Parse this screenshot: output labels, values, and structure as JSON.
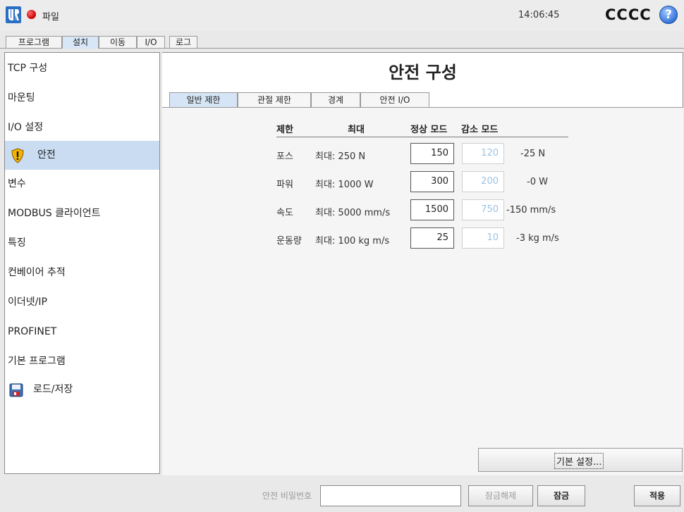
{
  "header": {
    "file_label": "파일",
    "clock": "14:06:45",
    "robot_name": "CCCC",
    "help_glyph": "?",
    "status_color": "#d40000"
  },
  "top_tabs": [
    "프로그램",
    "설치",
    "이동",
    "I/O",
    "로그"
  ],
  "active_top_tab": "설치",
  "sidebar": {
    "items": [
      {
        "label": "TCP 구성"
      },
      {
        "label": "마운팅"
      },
      {
        "label": "I/O 설정"
      },
      {
        "label": "안전",
        "icon": "warning-shield-icon",
        "active": true
      },
      {
        "label": "변수"
      },
      {
        "label": "MODBUS 클라이언트"
      },
      {
        "label": "특징"
      },
      {
        "label": "컨베이어 추적"
      },
      {
        "label": "이더넷/IP"
      },
      {
        "label": "PROFINET"
      },
      {
        "label": "기본 프로그램"
      },
      {
        "label": "로드/저장",
        "icon": "floppy-disk-icon"
      }
    ]
  },
  "main": {
    "title": "안전 구성",
    "subtabs": [
      "일반 제한",
      "관절 제한",
      "경계",
      "안전 I/O"
    ],
    "active_subtab": "일반 제한",
    "table": {
      "headers": {
        "limit": "제한",
        "max": "최대",
        "normal": "정상 모드",
        "reduced": "감소 모드"
      },
      "rows": [
        {
          "name": "포스",
          "max": "최대: 250 N",
          "normal": "150",
          "reduced": "120",
          "diff": "-25 N"
        },
        {
          "name": "파워",
          "max": "최대: 1000 W",
          "normal": "300",
          "reduced": "200",
          "diff": "-0 W"
        },
        {
          "name": "속도",
          "max": "최대: 5000 mm/s",
          "normal": "1500",
          "reduced": "750",
          "diff": "-150 mm/s"
        },
        {
          "name": "운동량",
          "max": "최대: 100 kg m/s",
          "normal": "25",
          "reduced": "10",
          "diff": "-3 kg m/s"
        }
      ]
    },
    "default_button": "기본 설정..."
  },
  "footer": {
    "password_label": "안전 비밀번호",
    "password_value": "",
    "unlock_button": "잠금해제",
    "lock_button": "잠금",
    "apply_button": "적용"
  }
}
